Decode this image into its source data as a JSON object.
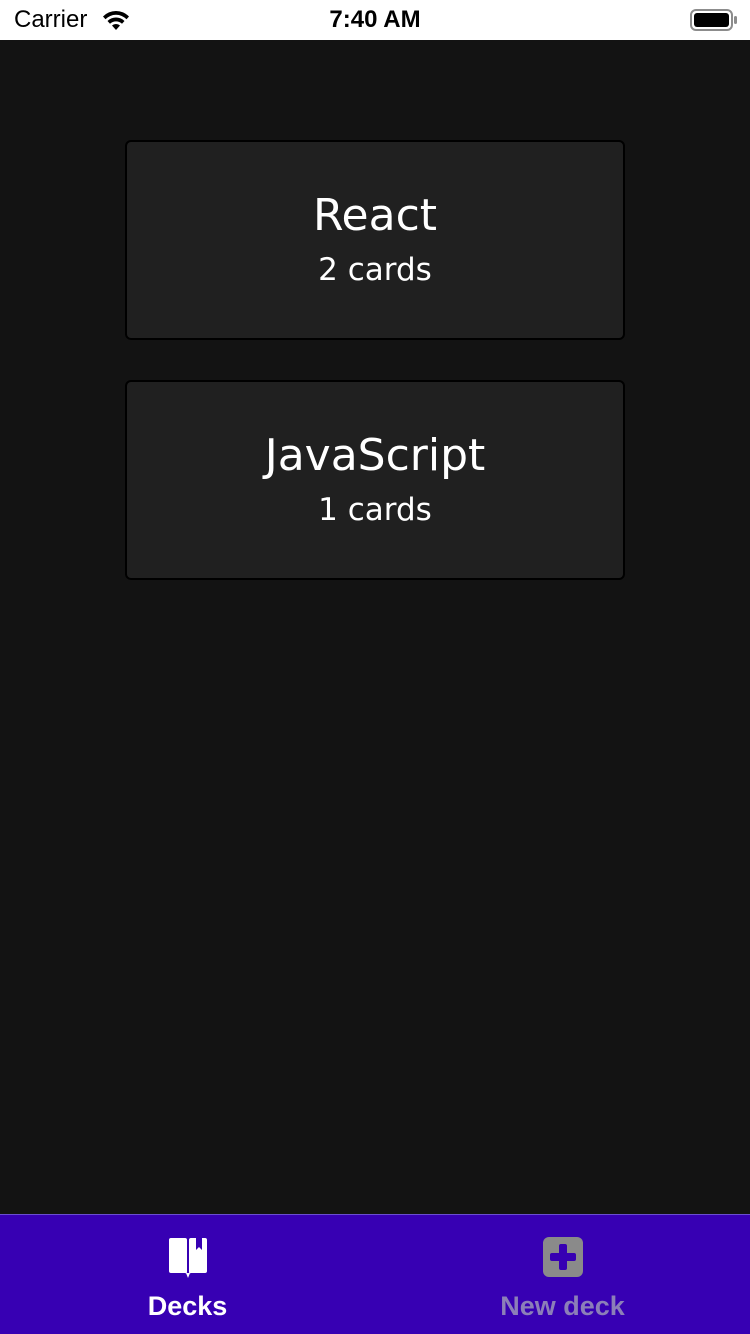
{
  "status_bar": {
    "carrier": "Carrier",
    "time": "7:40 AM",
    "wifi_icon": "wifi-icon",
    "battery_icon": "battery-icon"
  },
  "decks": [
    {
      "title": "React",
      "count": "2 cards"
    },
    {
      "title": "JavaScript",
      "count": "1 cards"
    }
  ],
  "tab_bar": {
    "tabs": [
      {
        "label": "Decks",
        "icon": "book-icon",
        "active": true
      },
      {
        "label": "New deck",
        "icon": "plus-square-icon",
        "active": false
      }
    ]
  },
  "colors": {
    "background": "#131313",
    "card": "#202020",
    "tab_bar": "#3700b3",
    "tab_active": "#ffffff",
    "tab_inactive": "#8c7fb8"
  }
}
